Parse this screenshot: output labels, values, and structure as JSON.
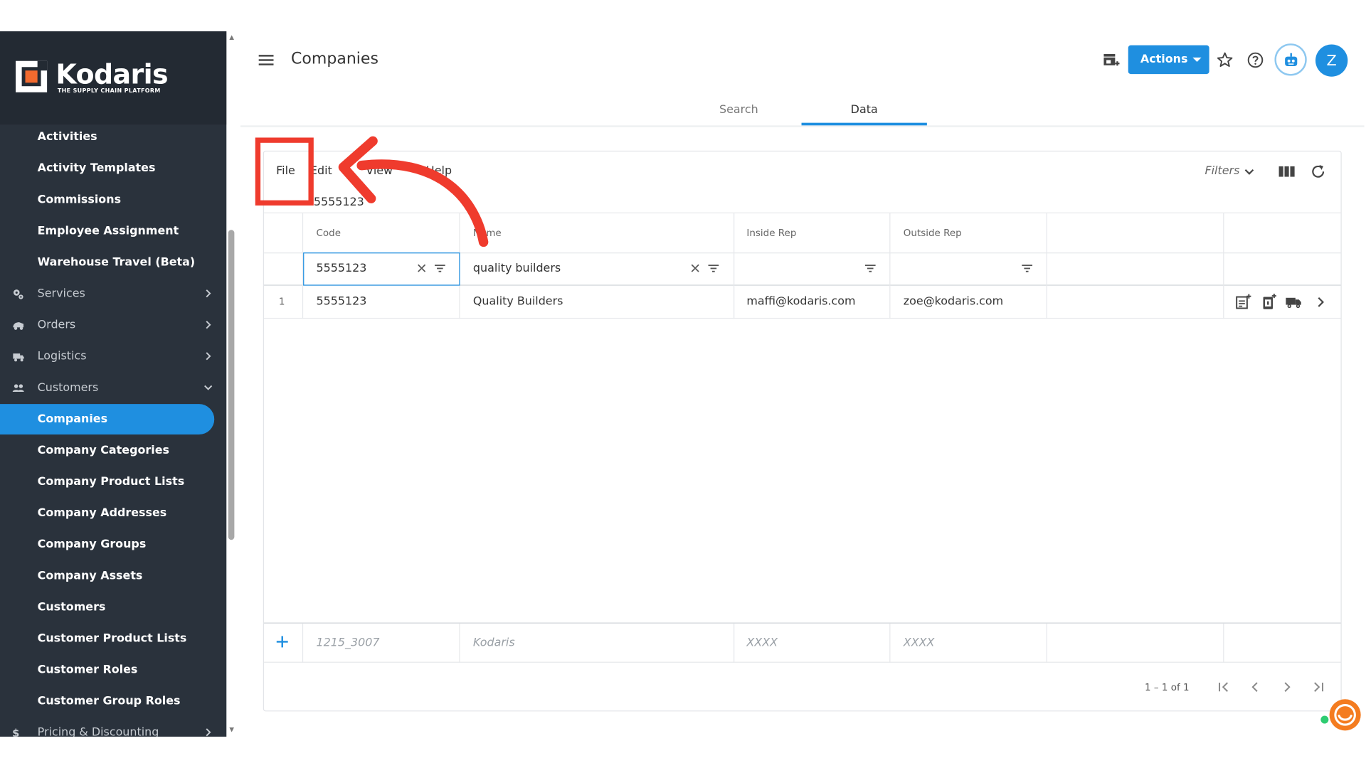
{
  "app": {
    "logo_name": "Kodaris",
    "logo_tagline": "THE SUPPLY CHAIN PLATFORM",
    "page_title": "Companies"
  },
  "sidebar": {
    "items": [
      {
        "label": "Activities",
        "type": "link"
      },
      {
        "label": "Activity Templates",
        "type": "link"
      },
      {
        "label": "Commissions",
        "type": "link"
      },
      {
        "label": "Employee Assignment",
        "type": "link"
      },
      {
        "label": "Warehouse Travel (Beta)",
        "type": "link"
      },
      {
        "label": "Services",
        "type": "section",
        "icon": "gears-icon"
      },
      {
        "label": "Orders",
        "type": "section",
        "icon": "truck-icon"
      },
      {
        "label": "Logistics",
        "type": "section",
        "icon": "shipping-icon"
      },
      {
        "label": "Customers",
        "type": "section",
        "icon": "people-icon",
        "expanded": true
      },
      {
        "label": "Companies",
        "type": "link",
        "active": true
      },
      {
        "label": "Company Categories",
        "type": "link"
      },
      {
        "label": "Company Product Lists",
        "type": "link"
      },
      {
        "label": "Company Addresses",
        "type": "link"
      },
      {
        "label": "Company Groups",
        "type": "link"
      },
      {
        "label": "Company Assets",
        "type": "link"
      },
      {
        "label": "Customers",
        "type": "link"
      },
      {
        "label": "Customer Product Lists",
        "type": "link"
      },
      {
        "label": "Customer Roles",
        "type": "link"
      },
      {
        "label": "Customer Group Roles",
        "type": "link"
      },
      {
        "label": "Pricing & Discounting",
        "type": "section",
        "icon": "dollar-icon"
      }
    ]
  },
  "header": {
    "actions_label": "Actions",
    "avatar_initial": "Z"
  },
  "tabs": [
    {
      "label": "Search",
      "active": false
    },
    {
      "label": "Data",
      "active": true
    }
  ],
  "grid": {
    "menu": [
      "File",
      "Edit",
      "View",
      "Help"
    ],
    "filters_label": "Filters",
    "selected_cell_value": "5555123",
    "columns": [
      "Code",
      "Name",
      "Inside Rep",
      "Outside Rep"
    ],
    "filters": {
      "code": "5555123",
      "name": "quality builders"
    },
    "rows": [
      {
        "num": "1",
        "code": "5555123",
        "name": "Quality Builders",
        "inside_rep": "maffi@kodaris.com",
        "outside_rep": "zoe@kodaris.com"
      }
    ],
    "new_row_placeholders": {
      "code": "1215_3007",
      "name": "Kodaris",
      "inside_rep": "XXXX",
      "outside_rep": "XXXX"
    },
    "pager_text": "1 – 1 of 1"
  },
  "colors": {
    "accent": "#1f8fe0",
    "sidebar_bg": "#2a323c",
    "annotation": "#ef3b2d"
  }
}
